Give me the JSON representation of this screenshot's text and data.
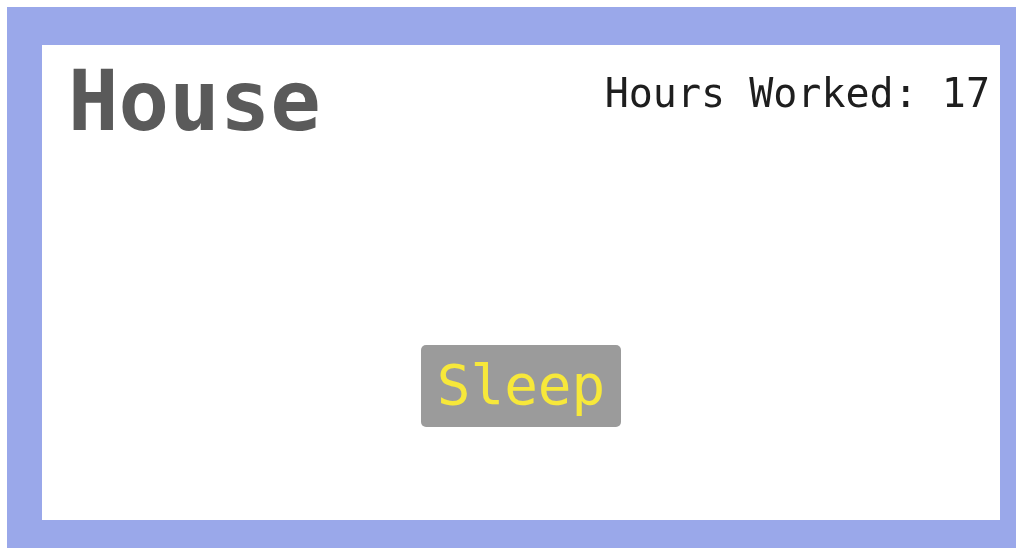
{
  "title": "House",
  "hours": "Hours Worked: 17",
  "button": {
    "label": "Sleep"
  }
}
